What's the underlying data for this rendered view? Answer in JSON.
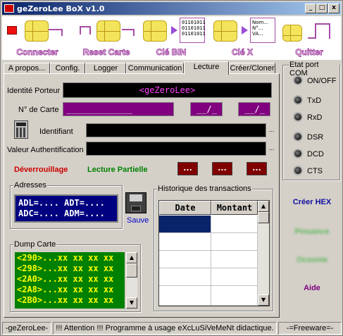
{
  "window": {
    "title": "geZeroLee BoX  v1.0",
    "minimize_icon": "minimize-icon",
    "maximize_icon": "maximize-icon",
    "close_icon": "close-icon"
  },
  "toolbar": {
    "connect": "Connecter",
    "reset": "Reset Carte",
    "cle_bin": "Clé BIN",
    "cle_x": "Clé X",
    "quit": "Quitter",
    "bits1": "01101011\n01101011\n01101011",
    "bits2": "Nom...\nN°...\nVA..."
  },
  "tabs": [
    "A propos...",
    "Config.",
    "Logger",
    "Communication",
    "Lecture",
    "Créer/Cloner"
  ],
  "active_tab": "Lecture",
  "lecture": {
    "identite_label": "Identité Porteur",
    "identite_value": "<geZeroLee>",
    "num_carte_label": "N° de Carte",
    "num_carte_value": "_____________",
    "date1_value": "__/_",
    "date2_value": "__/_",
    "identifiant_label": "Identifiant",
    "valeur_auth_label": "Valeur Authentification",
    "deverrouillage_label": "Déverrouillage",
    "lecture_partielle_label": "Lecture Partielle",
    "red_buttons": [
      "...",
      "...",
      "..."
    ],
    "adresses_title": "Adresses",
    "adl": "ADL=....",
    "adt": "ADT=....",
    "adc": "ADC=....",
    "adm": "ADM=....",
    "sauve_label": "Sauve",
    "historique_title": "Historique des transactions",
    "hist_columns": [
      "Date",
      "Montant"
    ],
    "dump_title": "Dump Carte",
    "dump_lines": [
      "<290>...xx xx xx xx",
      "<298>...xx xx xx xx",
      "<2A0>...xx xx xx xx",
      "<2A8>...xx xx xx xx",
      "<2B0>...xx xx xx xx"
    ]
  },
  "com_status": {
    "title": "Etat port COM",
    "signals": [
      "ON/OFF",
      "TxD",
      "RxD",
      "DSR",
      "DCD",
      "CTS"
    ]
  },
  "side_buttons": {
    "creer_hex": "Créer HEX",
    "blur1": "Pinuance",
    "blur2": "Ocounie",
    "aide": "Aide"
  },
  "statusbar": {
    "left": "-geZeroLee-",
    "middle": "!!! Attention !!! Programme à usage eXcLuSiVeMeNt didactique.",
    "right": "-=Freeware=-"
  },
  "colors": {
    "accent_purple": "#800080",
    "title_blue": "#0a246a",
    "deverrouillage_red": "#cc0000",
    "lecture_green": "#008000",
    "button_blue": "#000080"
  }
}
